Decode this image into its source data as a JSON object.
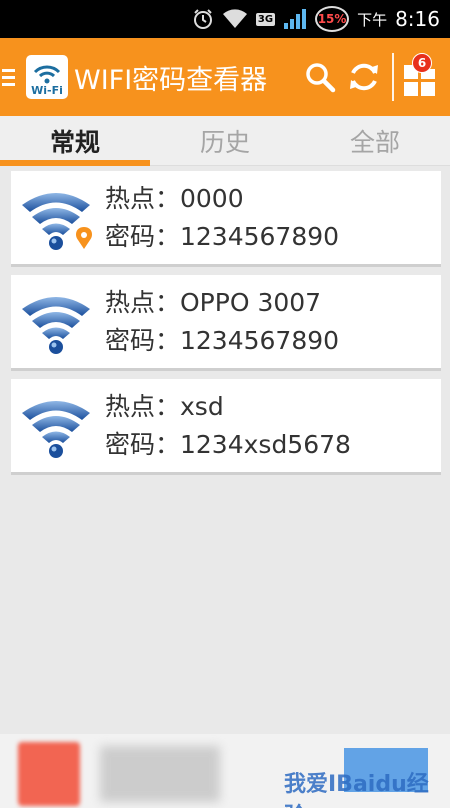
{
  "status_bar": {
    "time": "8:16",
    "period": "下午",
    "battery_percent": "15%",
    "network": "3G"
  },
  "app_bar": {
    "logo_text": "Wi-Fi",
    "title": "WIFI密码查看器",
    "badge_count": "6"
  },
  "tabs": [
    {
      "label": "常规",
      "active": true
    },
    {
      "label": "历史",
      "active": false
    },
    {
      "label": "全部",
      "active": false
    }
  ],
  "networks": [
    {
      "hotspot_line": "热点：0000",
      "password_line": "密码：1234567890",
      "location_marker": true
    },
    {
      "hotspot_line": "热点：OPPO 3007",
      "password_line": "密码：1234567890",
      "location_marker": false
    },
    {
      "hotspot_line": "热点：xsd",
      "password_line": "密码：1234xsd5678",
      "location_marker": false
    }
  ],
  "watermark": "我爱IBaidu经验",
  "colors": {
    "accent": "#f7921d",
    "wifi_blue": "#1b5fae",
    "badge_red": "#e8301c"
  },
  "icons": [
    "menu-icon",
    "wifi-logo-icon",
    "search-icon",
    "refresh-icon",
    "grid-icon",
    "wifi-icon",
    "location-pin-icon",
    "alarm-icon",
    "signal-icon"
  ]
}
